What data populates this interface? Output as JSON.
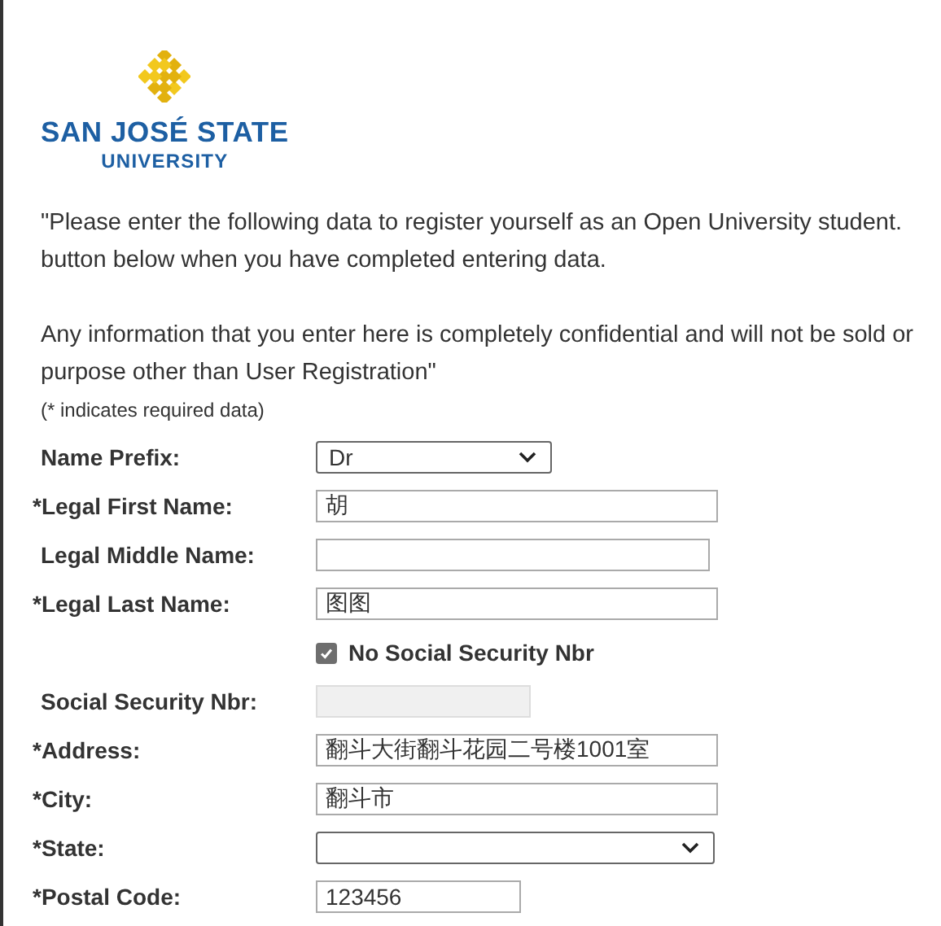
{
  "logo": {
    "name_line": "SAN JOSÉ STATE",
    "sub_line": "UNIVERSITY"
  },
  "intro": [
    {
      "lines": [
        "\"Please enter the following data to register yourself as an Open University student.",
        "button below when you have completed entering data."
      ]
    },
    {
      "lines": [
        "Any information that you enter here is completely confidential and will not be sold or",
        "purpose other than User Registration\""
      ]
    }
  ],
  "required_note": "(* indicates required data)",
  "fields": [
    {
      "kind": "select",
      "label": "Name Prefix:",
      "value": "Dr"
    },
    {
      "kind": "text",
      "label": "*Legal First Name:",
      "value": "胡"
    },
    {
      "kind": "text",
      "label": "Legal Middle Name:"
    },
    {
      "kind": "text",
      "label": "*Legal Last Name:",
      "value": "图图"
    },
    {
      "kind": "checkbox",
      "label": "No Social Security Nbr",
      "checked": true
    },
    {
      "kind": "text",
      "label": "Social Security Nbr:",
      "disabled": true
    },
    {
      "kind": "text",
      "label": "*Address:",
      "value": "翻斗大街翻斗花园二号楼1001室"
    },
    {
      "kind": "text",
      "label": "*City:",
      "value": "翻斗市"
    },
    {
      "kind": "select",
      "label": "*State:"
    },
    {
      "kind": "text",
      "label": "*Postal Code:",
      "value": "123456"
    }
  ]
}
